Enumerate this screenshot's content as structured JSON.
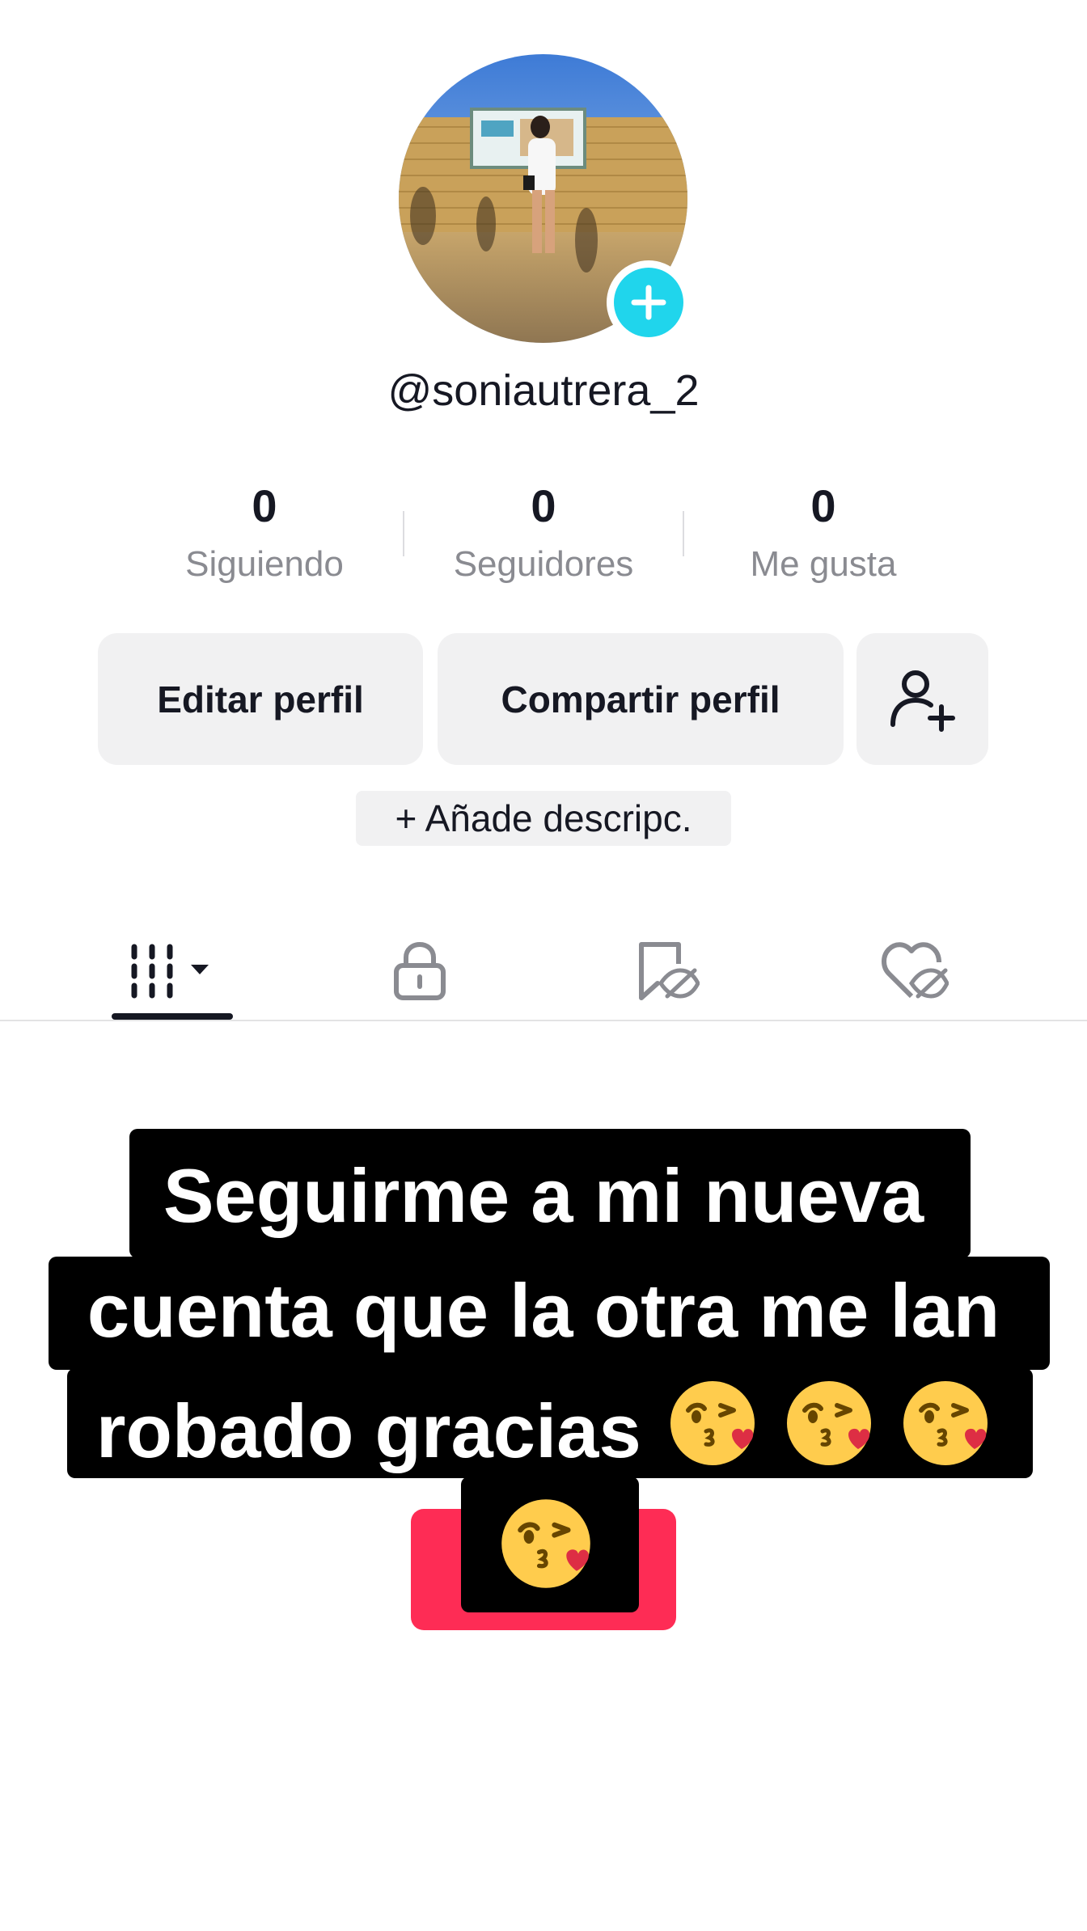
{
  "profile": {
    "username": "@soniautrera_2",
    "avatar_icon": "profile-photo",
    "add_icon": "plus-icon"
  },
  "stats": [
    {
      "value": "0",
      "label": "Siguiendo"
    },
    {
      "value": "0",
      "label": "Seguidores"
    },
    {
      "value": "0",
      "label": "Me gusta"
    }
  ],
  "actions": {
    "edit_label": "Editar perfil",
    "share_label": "Compartir perfil",
    "add_friend_icon": "add-friend-icon"
  },
  "bio": {
    "add_label": "+ Añade descripc."
  },
  "tabs": [
    {
      "icon": "grid-icon",
      "active": true
    },
    {
      "icon": "lock-icon",
      "active": false
    },
    {
      "icon": "bookmark-hidden-icon",
      "active": false
    },
    {
      "icon": "heart-hidden-icon",
      "active": false
    }
  ],
  "caption": {
    "line1": "Seguirme a mi nueva",
    "line2": "cuenta que la otra me lan",
    "line3": "robado gracias",
    "emoji": "😘",
    "emoji_icon": "face-blowing-kiss-icon"
  },
  "colors": {
    "accent_cyan": "#20d5ec",
    "brand_red": "#fe2c55",
    "text_primary": "#161823",
    "text_secondary": "#8a8b91",
    "button_bg": "#f1f1f2"
  }
}
